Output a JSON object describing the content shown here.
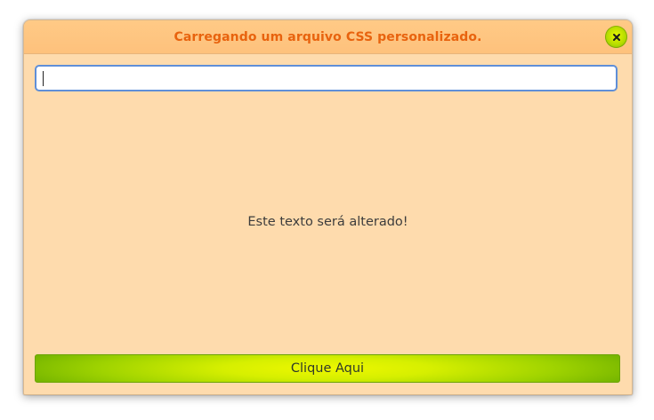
{
  "window": {
    "title": "Carregando um arquivo CSS personalizado."
  },
  "entry": {
    "value": ""
  },
  "label": {
    "text": "Este texto será alterado!"
  },
  "button": {
    "label": "Clique Aqui"
  },
  "icons": {
    "close": "close-icon"
  },
  "colors": {
    "window_bg": "#fedbad",
    "titlebar_bg": "#fec17c",
    "title_text": "#e8630e",
    "accent_green": "#a8d600",
    "entry_border": "#5f8fd8"
  }
}
